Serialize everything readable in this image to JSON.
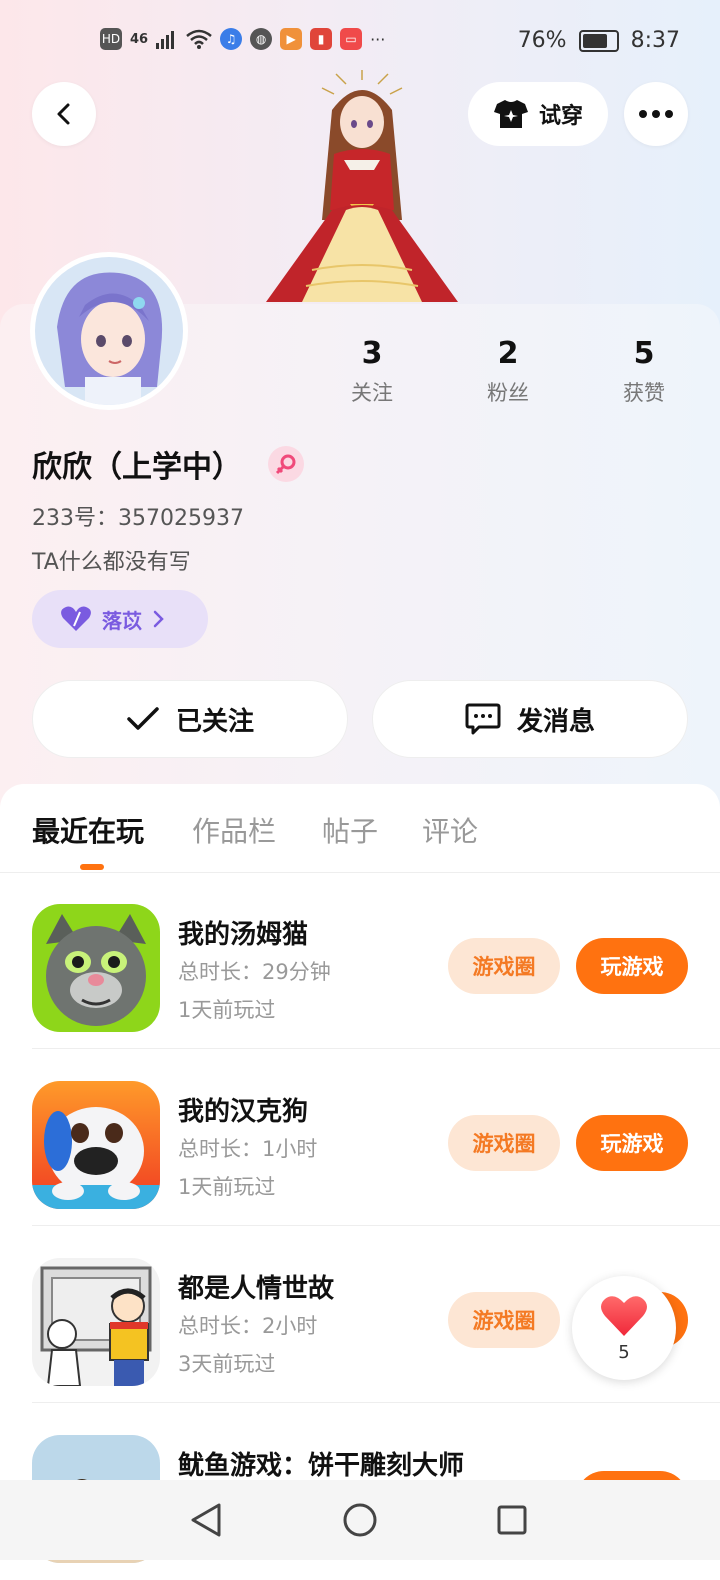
{
  "status_bar": {
    "network": "46",
    "hd": "HD",
    "battery": "76%",
    "time": "8:37",
    "more": "···"
  },
  "header": {
    "try_on_label": "试穿"
  },
  "profile": {
    "stats": [
      {
        "num": "3",
        "label": "关注"
      },
      {
        "num": "2",
        "label": "粉丝"
      },
      {
        "num": "5",
        "label": "获赞"
      }
    ],
    "name": "欣欣（上学中）",
    "uid": "233号：357025937",
    "bio": "TA什么都没有写",
    "tag_label": "落苡",
    "follow_label": "已关注",
    "message_label": "发消息"
  },
  "tabs": [
    "最近在玩",
    "作品栏",
    "帖子",
    "评论"
  ],
  "games": [
    {
      "title": "我的汤姆猫",
      "duration": "总时长：29分钟",
      "last": "1天前玩过",
      "circle": "游戏圈",
      "play": "玩游戏"
    },
    {
      "title": "我的汉克狗",
      "duration": "总时长：1小时",
      "last": "1天前玩过",
      "circle": "游戏圈",
      "play": "玩游戏"
    },
    {
      "title": "都是人情世故",
      "duration": "总时长：2小时",
      "last": "3天前玩过",
      "circle": "游戏圈",
      "play": "玩游戏"
    },
    {
      "title": "鱿鱼游戏：饼干雕刻大师",
      "duration": "",
      "last": "",
      "circle": "",
      "play": ""
    }
  ],
  "like_float": {
    "count": "5"
  },
  "colors": {
    "accent": "#ff7210",
    "accent_light": "#fde6d4",
    "tag_purple": "#7a5be0"
  }
}
